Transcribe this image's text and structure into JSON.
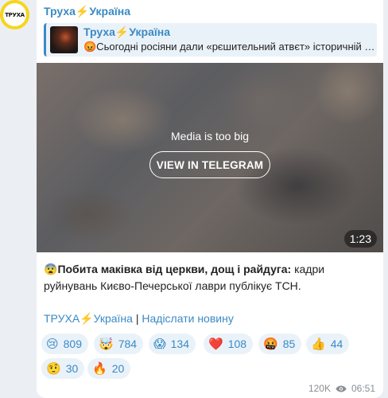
{
  "channel": {
    "avatar_text": "ТРУХА",
    "name": "Труха⚡Україна"
  },
  "reply": {
    "name": "Труха⚡Україна",
    "text": "😡Сьогодні росіяни дали «рєшительний атвєт» історичній памʼяті"
  },
  "media": {
    "message": "Media is too big",
    "button_label": "VIEW IN TELEGRAM",
    "duration": "1:23"
  },
  "caption": {
    "emoji": "😨",
    "bold": "Побита маківка від церкви, дощ і райдуга:",
    "text": " кадри руйнувань Києво-Печерської лаври публікує ТСН."
  },
  "links": {
    "channel": "ТРУХА⚡Україна",
    "separator": " | ",
    "submit": "Надіслати новину"
  },
  "reactions": [
    {
      "emoji": "😢",
      "count": "809"
    },
    {
      "emoji": "🤯",
      "count": "784"
    },
    {
      "emoji": "😱",
      "count": "134"
    },
    {
      "emoji": "❤️",
      "count": "108"
    },
    {
      "emoji": "🤬",
      "count": "85"
    },
    {
      "emoji": "👍",
      "count": "44"
    },
    {
      "emoji": "🤨",
      "count": "30"
    },
    {
      "emoji": "🔥",
      "count": "20"
    }
  ],
  "meta": {
    "views": "120K",
    "time": "06:51",
    "eye_icon": "eye-icon"
  }
}
